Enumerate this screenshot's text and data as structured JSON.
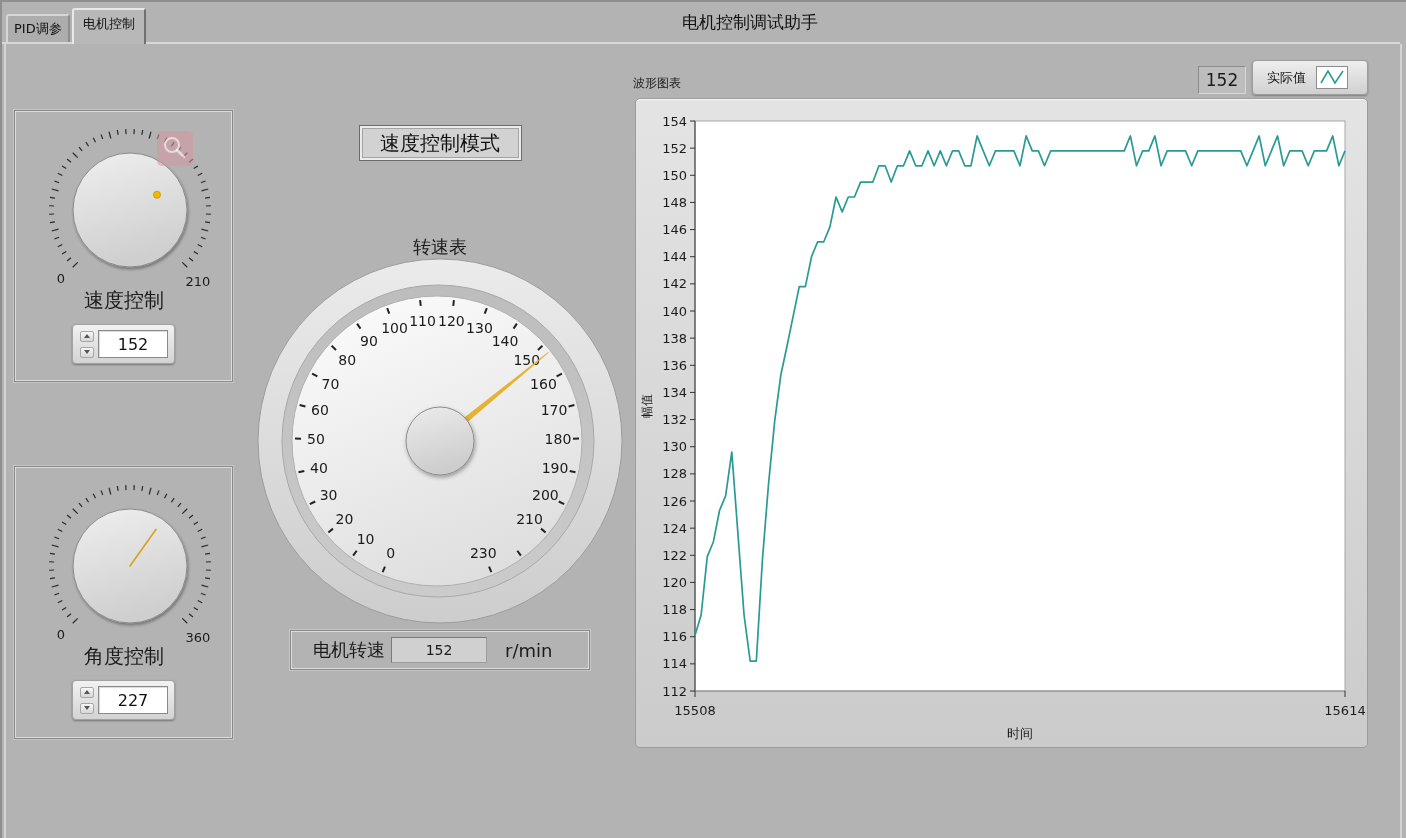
{
  "tabs": [
    {
      "label": "PID调参",
      "selected": false
    },
    {
      "label": "电机控制",
      "selected": true
    }
  ],
  "window": {
    "title": "电机控制调试助手"
  },
  "knobs": [
    {
      "kind": "dot",
      "min_label": "0",
      "max_label": "210",
      "label": "速度控制",
      "value": "152",
      "level": 0.724
    },
    {
      "kind": "line",
      "min_label": "0",
      "max_label": "360",
      "label": "角度控制",
      "value": "227",
      "level": 0.631
    }
  ],
  "mode_button": {
    "label": "速度控制模式"
  },
  "gauge": {
    "title": "转速表",
    "level": 0.661,
    "scale_left": [
      {
        "kind": "labeled",
        "label": "110"
      },
      {
        "kind": "labeled",
        "label": "100"
      },
      {
        "kind": "labeled",
        "label": "90"
      },
      {
        "kind": "labeled",
        "label": "80"
      },
      {
        "kind": "labeled",
        "label": "70"
      },
      {
        "kind": "labeled",
        "label": "60"
      },
      {
        "kind": "labeled",
        "label": "50"
      },
      {
        "kind": "labeled",
        "label": "40"
      },
      {
        "kind": "labeled",
        "label": "30"
      },
      {
        "kind": "labeled",
        "label": "20"
      },
      {
        "kind": "labeled",
        "label": "10"
      },
      {
        "kind": "labeled",
        "label": "0"
      }
    ],
    "scale_right": [
      {
        "kind": "labeled",
        "label": "120"
      },
      {
        "kind": "labeled",
        "label": "130"
      },
      {
        "kind": "labeled",
        "label": "140"
      },
      {
        "kind": "labeled",
        "label": "150"
      },
      {
        "kind": "labeled",
        "label": "160"
      },
      {
        "kind": "labeled",
        "label": "170"
      },
      {
        "kind": "labeled",
        "label": "180"
      },
      {
        "kind": "labeled",
        "label": "190"
      },
      {
        "kind": "labeled",
        "label": "200"
      },
      {
        "kind": "labeled",
        "label": "210"
      },
      {
        "kind": "plain"
      },
      {
        "kind": "labeled",
        "label": "230"
      }
    ]
  },
  "readout": {
    "label": "电机转速",
    "value": "152",
    "unit": "r/min"
  },
  "chart": {
    "digital_display": "152",
    "chart_data": {
      "type": "line",
      "title": "波形图表",
      "xlabel": "时间",
      "ylabel": "幅值",
      "xlim": [
        15508,
        15614
      ],
      "ylim": [
        112,
        154
      ],
      "xticks": [
        15508,
        15614
      ],
      "yticks": [
        112,
        114,
        116,
        118,
        120,
        122,
        124,
        126,
        128,
        130,
        132,
        134,
        136,
        138,
        140,
        142,
        144,
        146,
        148,
        150,
        152,
        154
      ],
      "x": [
        15508,
        15509,
        15510,
        15511,
        15512,
        15513,
        15514,
        15515,
        15516,
        15517,
        15518,
        15519,
        15520,
        15521,
        15522,
        15523,
        15524,
        15525,
        15526,
        15527,
        15528,
        15529,
        15530,
        15531,
        15532,
        15533,
        15534,
        15535,
        15536,
        15537,
        15538,
        15539,
        15540,
        15541,
        15542,
        15543,
        15544,
        15545,
        15546,
        15547,
        15548,
        15549,
        15550,
        15551,
        15552,
        15553,
        15554,
        15555,
        15556,
        15557,
        15558,
        15559,
        15560,
        15561,
        15562,
        15563,
        15564,
        15565,
        15566,
        15567,
        15568,
        15569,
        15570,
        15571,
        15572,
        15573,
        15574,
        15575,
        15576,
        15577,
        15578,
        15579,
        15580,
        15581,
        15582,
        15583,
        15584,
        15585,
        15586,
        15587,
        15588,
        15589,
        15590,
        15591,
        15592,
        15593,
        15594,
        15595,
        15596,
        15597,
        15598,
        15599,
        15600,
        15601,
        15602,
        15603,
        15604,
        15605,
        15606,
        15607,
        15608,
        15609,
        15610,
        15611,
        15612,
        15613,
        15614
      ],
      "series": [
        {
          "name": "实际值",
          "color": "#2a9a94",
          "values": [
            116.1,
            117.6,
            121.9,
            123.0,
            125.3,
            126.4,
            129.6,
            123.6,
            117.6,
            114.2,
            114.2,
            121.7,
            127.3,
            131.9,
            135.3,
            137.4,
            139.6,
            141.8,
            141.8,
            144.0,
            145.1,
            145.1,
            146.2,
            148.4,
            147.3,
            148.4,
            148.4,
            149.5,
            149.5,
            149.5,
            150.7,
            150.7,
            149.5,
            150.7,
            150.7,
            151.8,
            150.7,
            150.7,
            151.8,
            150.7,
            151.8,
            150.7,
            151.8,
            151.8,
            150.7,
            150.7,
            152.9,
            151.8,
            150.7,
            151.8,
            151.8,
            151.8,
            151.8,
            150.7,
            152.9,
            151.8,
            151.8,
            150.7,
            151.8,
            151.8,
            151.8,
            151.8,
            151.8,
            151.8,
            151.8,
            151.8,
            151.8,
            151.8,
            151.8,
            151.8,
            151.8,
            152.9,
            150.7,
            151.8,
            151.8,
            152.9,
            150.7,
            151.8,
            151.8,
            151.8,
            151.8,
            150.7,
            151.8,
            151.8,
            151.8,
            151.8,
            151.8,
            151.8,
            151.8,
            151.8,
            150.7,
            151.8,
            152.9,
            150.7,
            151.8,
            152.9,
            150.7,
            151.8,
            151.8,
            151.8,
            150.7,
            151.8,
            151.8,
            151.8,
            152.9,
            150.7,
            151.8
          ]
        }
      ]
    }
  }
}
